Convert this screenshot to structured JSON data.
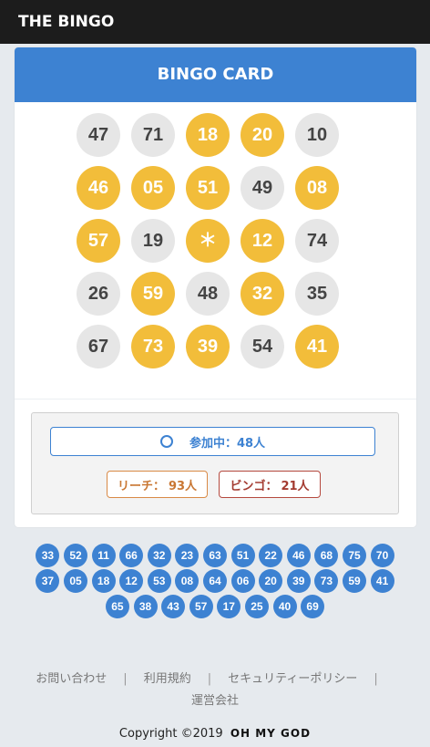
{
  "header": {
    "title": "THE BINGO"
  },
  "card": {
    "title": "BINGO CARD",
    "rows": [
      [
        {
          "n": "47",
          "hit": false
        },
        {
          "n": "71",
          "hit": false
        },
        {
          "n": "18",
          "hit": true
        },
        {
          "n": "20",
          "hit": true
        },
        {
          "n": "10",
          "hit": false
        }
      ],
      [
        {
          "n": "46",
          "hit": true
        },
        {
          "n": "05",
          "hit": true
        },
        {
          "n": "51",
          "hit": true
        },
        {
          "n": "49",
          "hit": false
        },
        {
          "n": "08",
          "hit": true
        }
      ],
      [
        {
          "n": "57",
          "hit": true
        },
        {
          "n": "19",
          "hit": false
        },
        {
          "n": "＊",
          "hit": true
        },
        {
          "n": "12",
          "hit": true
        },
        {
          "n": "74",
          "hit": false
        }
      ],
      [
        {
          "n": "26",
          "hit": false
        },
        {
          "n": "59",
          "hit": true
        },
        {
          "n": "48",
          "hit": false
        },
        {
          "n": "32",
          "hit": true
        },
        {
          "n": "35",
          "hit": false
        }
      ],
      [
        {
          "n": "67",
          "hit": false
        },
        {
          "n": "73",
          "hit": true
        },
        {
          "n": "39",
          "hit": true
        },
        {
          "n": "54",
          "hit": false
        },
        {
          "n": "41",
          "hit": true
        }
      ]
    ]
  },
  "status": {
    "joining_label": "参加中：48人",
    "reach_label": "リーチ：",
    "reach_count": "93人",
    "bingo_label": "ビンゴ：",
    "bingo_count": "21人"
  },
  "drawn_numbers": [
    [
      "33",
      "52",
      "11",
      "66",
      "32",
      "23",
      "63",
      "51",
      "22",
      "46",
      "68",
      "75",
      "70"
    ],
    [
      "37",
      "05",
      "18",
      "12",
      "53",
      "08",
      "64",
      "06",
      "20",
      "39",
      "73",
      "59",
      "41"
    ],
    [
      "65",
      "38",
      "43",
      "57",
      "17",
      "25",
      "40",
      "69"
    ]
  ],
  "footer": {
    "links": [
      "お問い合わせ",
      "利用規約",
      "セキュリティーポリシー",
      "運営会社"
    ],
    "separator": "|",
    "copyright": "Copyright ©2019",
    "logo_text": "OH MY GOD"
  },
  "colors": {
    "accent_blue": "#3d82d2",
    "hit_yellow": "#f2bd3a",
    "miss_gray": "#e6e6e6",
    "reach_orange": "#d98a46",
    "bingo_red": "#b5493e"
  }
}
